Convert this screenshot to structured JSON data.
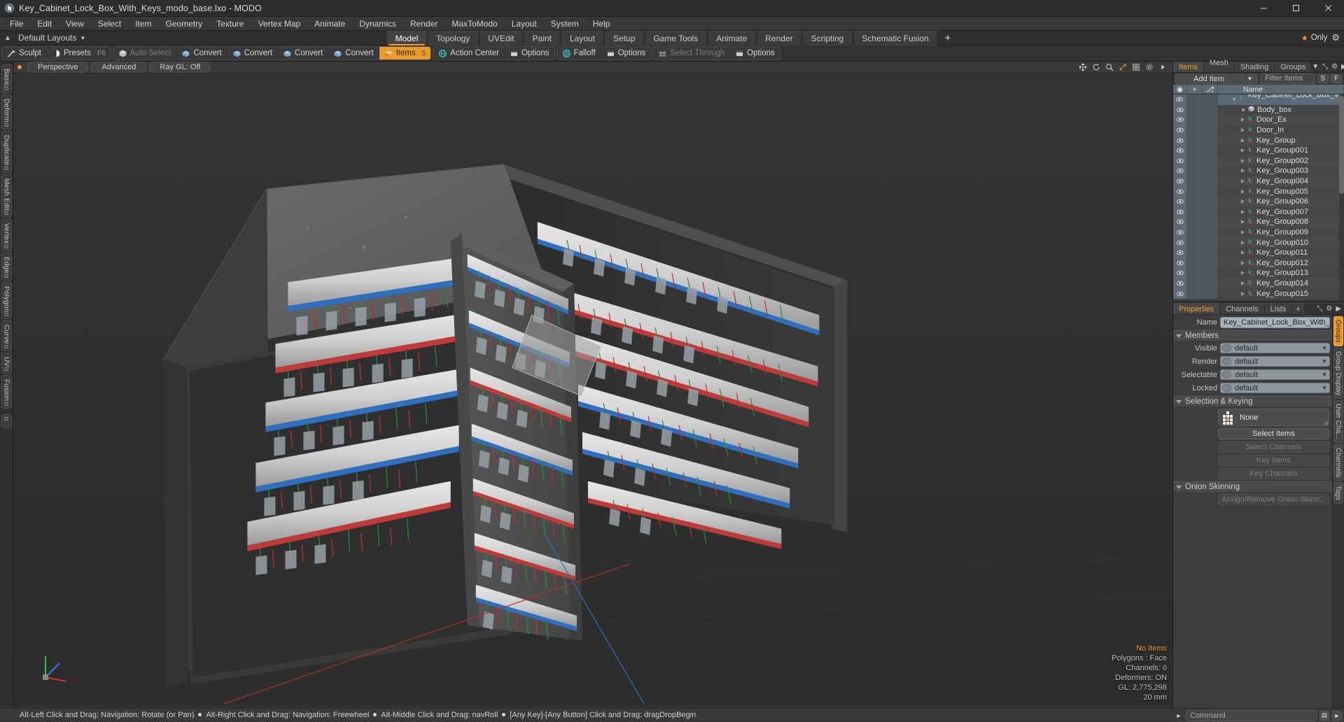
{
  "window": {
    "title": "Key_Cabinet_Lock_Box_With_Keys_modo_base.lxo - MODO",
    "minimize": "–",
    "maximize": "☐",
    "close": "✕"
  },
  "menubar": {
    "items": [
      "File",
      "Edit",
      "View",
      "Select",
      "Item",
      "Geometry",
      "Texture",
      "Vertex Map",
      "Animate",
      "Dynamics",
      "Render",
      "MaxToModo",
      "Layout",
      "System",
      "Help"
    ]
  },
  "layoutrow": {
    "default_layouts": "Default Layouts",
    "tabs": [
      {
        "label": "Model",
        "active": true
      },
      {
        "label": "Topology",
        "active": false
      },
      {
        "label": "UVEdit",
        "active": false
      },
      {
        "label": "Paint",
        "active": false
      },
      {
        "label": "Layout",
        "active": false
      },
      {
        "label": "Setup",
        "active": false
      },
      {
        "label": "Game Tools",
        "active": false
      },
      {
        "label": "Animate",
        "active": false
      },
      {
        "label": "Render",
        "active": false
      },
      {
        "label": "Scripting",
        "active": false
      },
      {
        "label": "Schematic Fusion",
        "active": false
      }
    ],
    "add_tab": "+",
    "only_label": "Only"
  },
  "toolbar": {
    "groups": [
      {
        "buttons": [
          {
            "label": "Sculpt",
            "icon": "brush-icon",
            "state": "normal",
            "key": ""
          },
          {
            "label": "Presets",
            "icon": "sphere-icon",
            "state": "normal",
            "key": "F6"
          }
        ]
      },
      {
        "buttons": [
          {
            "label": "Auto Select",
            "icon": "cube-grey-icon",
            "state": "disabled",
            "key": ""
          },
          {
            "label": "Convert",
            "icon": "convert-blue-icon",
            "state": "normal",
            "key": ""
          },
          {
            "label": "Convert",
            "icon": "convert-blue-icon",
            "state": "normal",
            "key": ""
          },
          {
            "label": "Convert",
            "icon": "convert-blue-icon",
            "state": "normal",
            "key": ""
          },
          {
            "label": "Convert",
            "icon": "convert-blue-icon",
            "state": "normal",
            "key": ""
          },
          {
            "label": "Items",
            "icon": "items-orange-icon",
            "state": "active",
            "key": "5"
          }
        ]
      },
      {
        "buttons": [
          {
            "label": "Action Center",
            "icon": "globe-icon",
            "state": "normal",
            "key": ""
          },
          {
            "label": "Options",
            "icon": "panel-icon",
            "state": "normal",
            "key": ""
          }
        ]
      },
      {
        "buttons": [
          {
            "label": "Falloff",
            "icon": "falloff-icon",
            "state": "normal",
            "key": ""
          },
          {
            "label": "Options",
            "icon": "panel-icon",
            "state": "normal",
            "key": ""
          }
        ]
      },
      {
        "buttons": [
          {
            "label": "Select Through",
            "icon": "eyes-icon",
            "state": "disabled",
            "key": ""
          },
          {
            "label": "Options",
            "icon": "panel-icon",
            "state": "normal",
            "key": ""
          }
        ]
      }
    ]
  },
  "leftstrip": {
    "tabs": [
      "Basic",
      "Deform",
      "Duplicate",
      "Mesh Edit",
      "Vertex",
      "Edge",
      "Polygon",
      "Curve",
      "UV",
      "Fusion"
    ]
  },
  "viewport": {
    "header": {
      "view_mode": "Perspective",
      "shading": "Advanced",
      "raygl": "Ray GL: Off",
      "icons": [
        "move-icon",
        "rotate-icon",
        "zoom-icon",
        "fit-icon",
        "grid-icon",
        "gear-icon",
        "chevron-right-icon"
      ]
    },
    "stats": {
      "selection": "No Items",
      "polygons": "Polygons : Face",
      "channels": "Channels: 0",
      "deformers": "Deformers: ON",
      "gl": "GL: 2,775,298",
      "grid": "20 mm"
    }
  },
  "rightpanel": {
    "tabs": [
      {
        "label": "Items",
        "active": true
      },
      {
        "label": "Mesh ...",
        "active": false
      },
      {
        "label": "Shading",
        "active": false
      },
      {
        "label": "Groups",
        "active": false
      }
    ],
    "tab_icons": [
      "chevron-down-icon",
      "expand-icon",
      "gear-icon",
      "chevron-right-icon"
    ],
    "add_item": "Add Item",
    "filter_placeholder": "Filter Items",
    "filter_buttons": [
      "S",
      "F"
    ],
    "list_header": {
      "eye": "◉",
      "col2": "+",
      "col3": "⎇",
      "name": "Name"
    },
    "items": [
      {
        "label": "Key_Cabinet_Lock_Box_Wi ...",
        "depth": 0,
        "icon": "locator-icon",
        "expanded": true,
        "selected": true
      },
      {
        "label": "Body_box",
        "depth": 1,
        "icon": "mesh-icon",
        "expanded": false,
        "selected": false
      },
      {
        "label": "Door_Ex",
        "depth": 1,
        "icon": "locator-icon",
        "expanded": false,
        "selected": false
      },
      {
        "label": "Door_In",
        "depth": 1,
        "icon": "locator-icon",
        "expanded": false,
        "selected": false
      },
      {
        "label": "Key_Group",
        "depth": 1,
        "icon": "locator-icon",
        "expanded": false,
        "selected": false
      },
      {
        "label": "Key_Group001",
        "depth": 1,
        "icon": "locator-icon",
        "expanded": false,
        "selected": false
      },
      {
        "label": "Key_Group002",
        "depth": 1,
        "icon": "locator-icon",
        "expanded": false,
        "selected": false
      },
      {
        "label": "Key_Group003",
        "depth": 1,
        "icon": "locator-icon",
        "expanded": false,
        "selected": false
      },
      {
        "label": "Key_Group004",
        "depth": 1,
        "icon": "locator-icon",
        "expanded": false,
        "selected": false
      },
      {
        "label": "Key_Group005",
        "depth": 1,
        "icon": "locator-icon",
        "expanded": false,
        "selected": false
      },
      {
        "label": "Key_Group006",
        "depth": 1,
        "icon": "locator-icon",
        "expanded": false,
        "selected": false
      },
      {
        "label": "Key_Group007",
        "depth": 1,
        "icon": "locator-icon",
        "expanded": false,
        "selected": false
      },
      {
        "label": "Key_Group008",
        "depth": 1,
        "icon": "locator-icon",
        "expanded": false,
        "selected": false
      },
      {
        "label": "Key_Group009",
        "depth": 1,
        "icon": "locator-icon",
        "expanded": false,
        "selected": false
      },
      {
        "label": "Key_Group010",
        "depth": 1,
        "icon": "locator-icon",
        "expanded": false,
        "selected": false
      },
      {
        "label": "Key_Group011",
        "depth": 1,
        "icon": "locator-icon",
        "expanded": false,
        "selected": false
      },
      {
        "label": "Key_Group012",
        "depth": 1,
        "icon": "locator-icon",
        "expanded": false,
        "selected": false
      },
      {
        "label": "Key_Group013",
        "depth": 1,
        "icon": "locator-icon",
        "expanded": false,
        "selected": false
      },
      {
        "label": "Key_Group014",
        "depth": 1,
        "icon": "locator-icon",
        "expanded": false,
        "selected": false
      },
      {
        "label": "Key_Group015",
        "depth": 1,
        "icon": "locator-icon",
        "expanded": false,
        "selected": false
      }
    ]
  },
  "properties": {
    "tabs": [
      {
        "label": "Properties",
        "active": true
      },
      {
        "label": "Channels",
        "active": false
      },
      {
        "label": "Lists",
        "active": false
      },
      {
        "label": "+",
        "active": false
      }
    ],
    "name_label": "Name",
    "name_value": "Key_Cabinet_Lock_Box_With_Ke",
    "sections": [
      {
        "title": "Members",
        "fields": [
          {
            "label": "Visible",
            "value": "default"
          },
          {
            "label": "Render",
            "value": "default"
          },
          {
            "label": "Selectable",
            "value": "default"
          },
          {
            "label": "Locked",
            "value": "default"
          }
        ]
      }
    ],
    "selection_keying": {
      "title": "Selection & Keying",
      "set_value": "None",
      "buttons": [
        {
          "label": "Select Items",
          "disabled": false
        },
        {
          "label": "Select Channels",
          "disabled": true
        },
        {
          "label": "Key Items",
          "disabled": true
        },
        {
          "label": "Key Channels",
          "disabled": true
        }
      ]
    },
    "onion_skinning": {
      "title": "Onion Skinning",
      "button": {
        "label": "Assign/Remove Onion Skinn...",
        "disabled": true
      }
    },
    "side_tabs": [
      {
        "label": "Groups",
        "active": true
      },
      {
        "label": "Group Display",
        "active": false
      },
      {
        "label": "User Cha...",
        "active": false
      },
      {
        "label": "Channels",
        "active": false
      },
      {
        "label": "Tags",
        "active": false
      }
    ]
  },
  "commandbar": {
    "placeholder": "Command",
    "icons": [
      "keyboard-icon",
      "chevron-right-icon"
    ]
  },
  "statusbar": {
    "hints": [
      "Alt-Left Click and Drag: Navigation: Rotate (or Pan)",
      "Alt-Right Click and Drag: Navigation: Freewheel",
      "Alt-Middle Click and Drag: navRoll",
      "[Any Key]-[Any Button] Click and Drag: dragDropBegin"
    ]
  },
  "colors": {
    "accent": "#e89a2c",
    "panel": "#3a3a3a",
    "viewport_bg": "#303030",
    "highlight_text": "#e9a33a"
  }
}
